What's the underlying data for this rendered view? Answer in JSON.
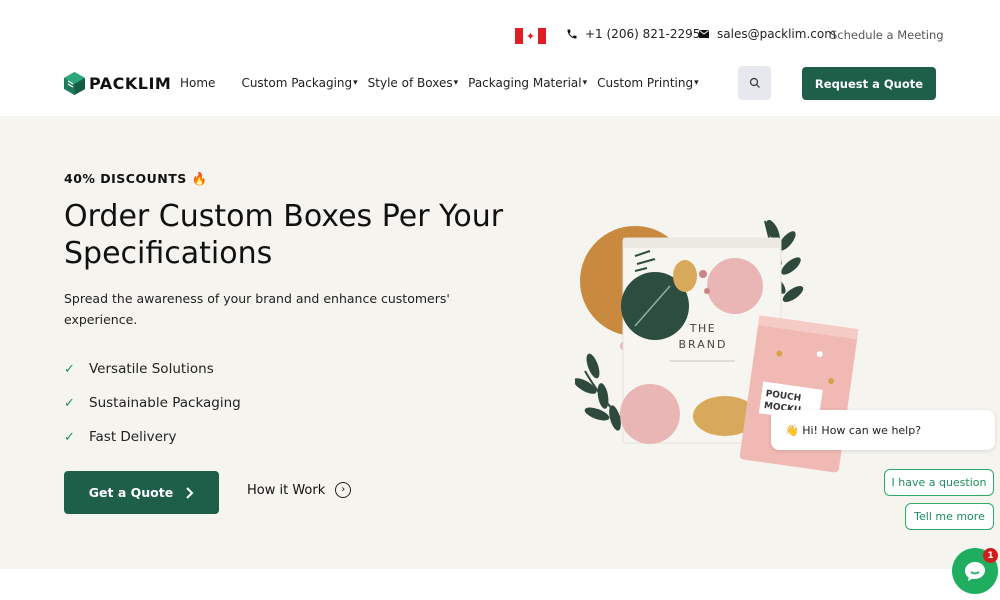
{
  "topbar": {
    "flag": "canada-flag",
    "phone": "+1 (206) 821-2295",
    "email": "sales@packlim.com",
    "meeting": "Schedule a Meeting"
  },
  "header": {
    "logo_text": "PACKLIM",
    "nav": [
      {
        "label": "Home",
        "has_caret": false
      },
      {
        "label": "Custom Packaging",
        "has_caret": true
      },
      {
        "label": "Style of Boxes",
        "has_caret": true
      },
      {
        "label": "Packaging Material",
        "has_caret": true
      },
      {
        "label": "Custom Printing",
        "has_caret": true
      }
    ],
    "caret": "▾",
    "search_icon": "search-icon",
    "quote_button": "Request a Quote"
  },
  "hero": {
    "badge": "40% DISCOUNTS 🔥",
    "title": "Order Custom Boxes Per Your Specifications",
    "subtitle": "Spread the awareness of your brand and enhance customers' experience.",
    "features": [
      "Versatile Solutions",
      "Sustainable Packaging",
      "Fast Delivery"
    ],
    "cta_primary": "Get a Quote",
    "cta_secondary": "How it Work",
    "illustration": {
      "pouch_front_text_1": "THE",
      "pouch_front_text_2": "BRAND",
      "pouch_back_text_1": "POUCH",
      "pouch_back_text_2": "MOCKU"
    }
  },
  "chat": {
    "greeting": "👋 Hi! How can we help?",
    "options": [
      "I have a question",
      "Tell me more"
    ],
    "unread_count": "1"
  },
  "colors": {
    "brand_green": "#1e5f4a",
    "hero_bg": "#f5f4ef",
    "chat_green": "#1fae60"
  }
}
